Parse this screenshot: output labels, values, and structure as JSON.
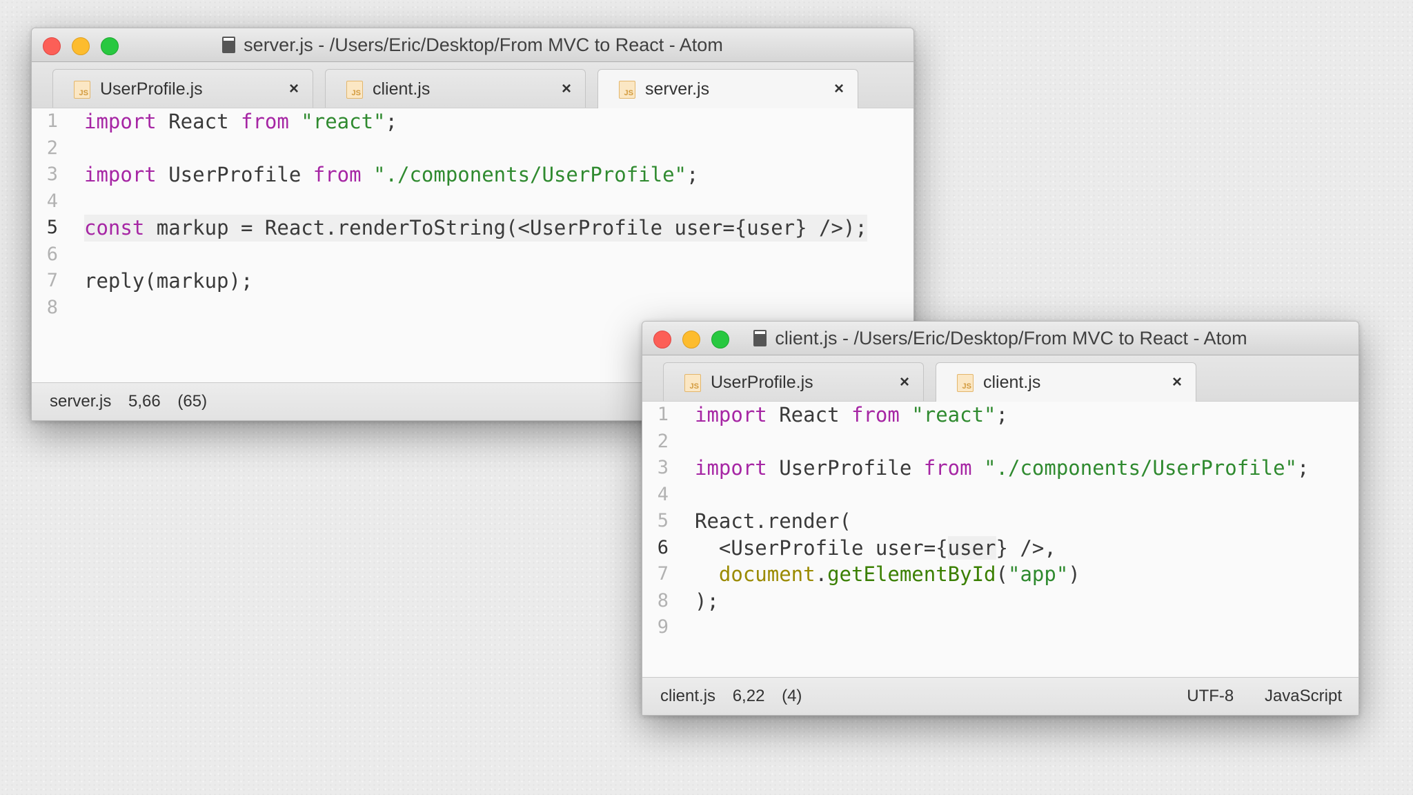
{
  "server_window": {
    "title": "server.js - /Users/Eric/Desktop/From MVC to React - Atom",
    "tabs": [
      {
        "label": "UserProfile.js",
        "icon": "js-file-icon",
        "active": false
      },
      {
        "label": "client.js",
        "icon": "js-file-icon",
        "active": false
      },
      {
        "label": "server.js",
        "icon": "js-file-icon",
        "active": true
      }
    ],
    "lines": [
      {
        "n": "1"
      },
      {
        "n": "2"
      },
      {
        "n": "3"
      },
      {
        "n": "4"
      },
      {
        "n": "5"
      },
      {
        "n": "6"
      },
      {
        "n": "7"
      },
      {
        "n": "8"
      }
    ],
    "code": {
      "l1": [
        "import",
        " React ",
        "from",
        " ",
        "\"react\"",
        ";"
      ],
      "l3": [
        "import",
        " UserProfile ",
        "from",
        " ",
        "\"./components/UserProfile\"",
        ";"
      ],
      "l5": [
        "const",
        " markup = React.renderToString(<UserProfile user={user} />);"
      ],
      "l7": "reply(markup);"
    },
    "status": {
      "file": "server.js",
      "cursor": "5,66",
      "selection": "(65)"
    }
  },
  "client_window": {
    "title": "client.js - /Users/Eric/Desktop/From MVC to React - Atom",
    "tabs": [
      {
        "label": "UserProfile.js",
        "icon": "js-file-icon",
        "active": false
      },
      {
        "label": "client.js",
        "icon": "js-file-icon",
        "active": true
      }
    ],
    "lines": [
      {
        "n": "1"
      },
      {
        "n": "2"
      },
      {
        "n": "3"
      },
      {
        "n": "4"
      },
      {
        "n": "5"
      },
      {
        "n": "6"
      },
      {
        "n": "7"
      },
      {
        "n": "8"
      },
      {
        "n": "9"
      }
    ],
    "code": {
      "l1": [
        "import",
        " React ",
        "from",
        " ",
        "\"react\"",
        ";"
      ],
      "l3": [
        "import",
        " UserProfile ",
        "from",
        " ",
        "\"./components/UserProfile\"",
        ";"
      ],
      "l5": "React.render(",
      "l6": [
        "  <UserProfile user={",
        "user",
        "} />,"
      ],
      "l7": [
        "  ",
        "document",
        ".",
        "getElementById",
        "(",
        "\"app\"",
        ")"
      ],
      "l8": ");"
    },
    "status": {
      "file": "client.js",
      "cursor": "6,22",
      "selection": "(4)",
      "encoding": "UTF-8",
      "grammar": "JavaScript"
    }
  },
  "close_glyph": "×",
  "colors": {
    "keyword": "#a626a4",
    "string": "#2f8a2f",
    "close": "#fc5f57",
    "minimize": "#fdbc2e",
    "zoom": "#28c840"
  }
}
